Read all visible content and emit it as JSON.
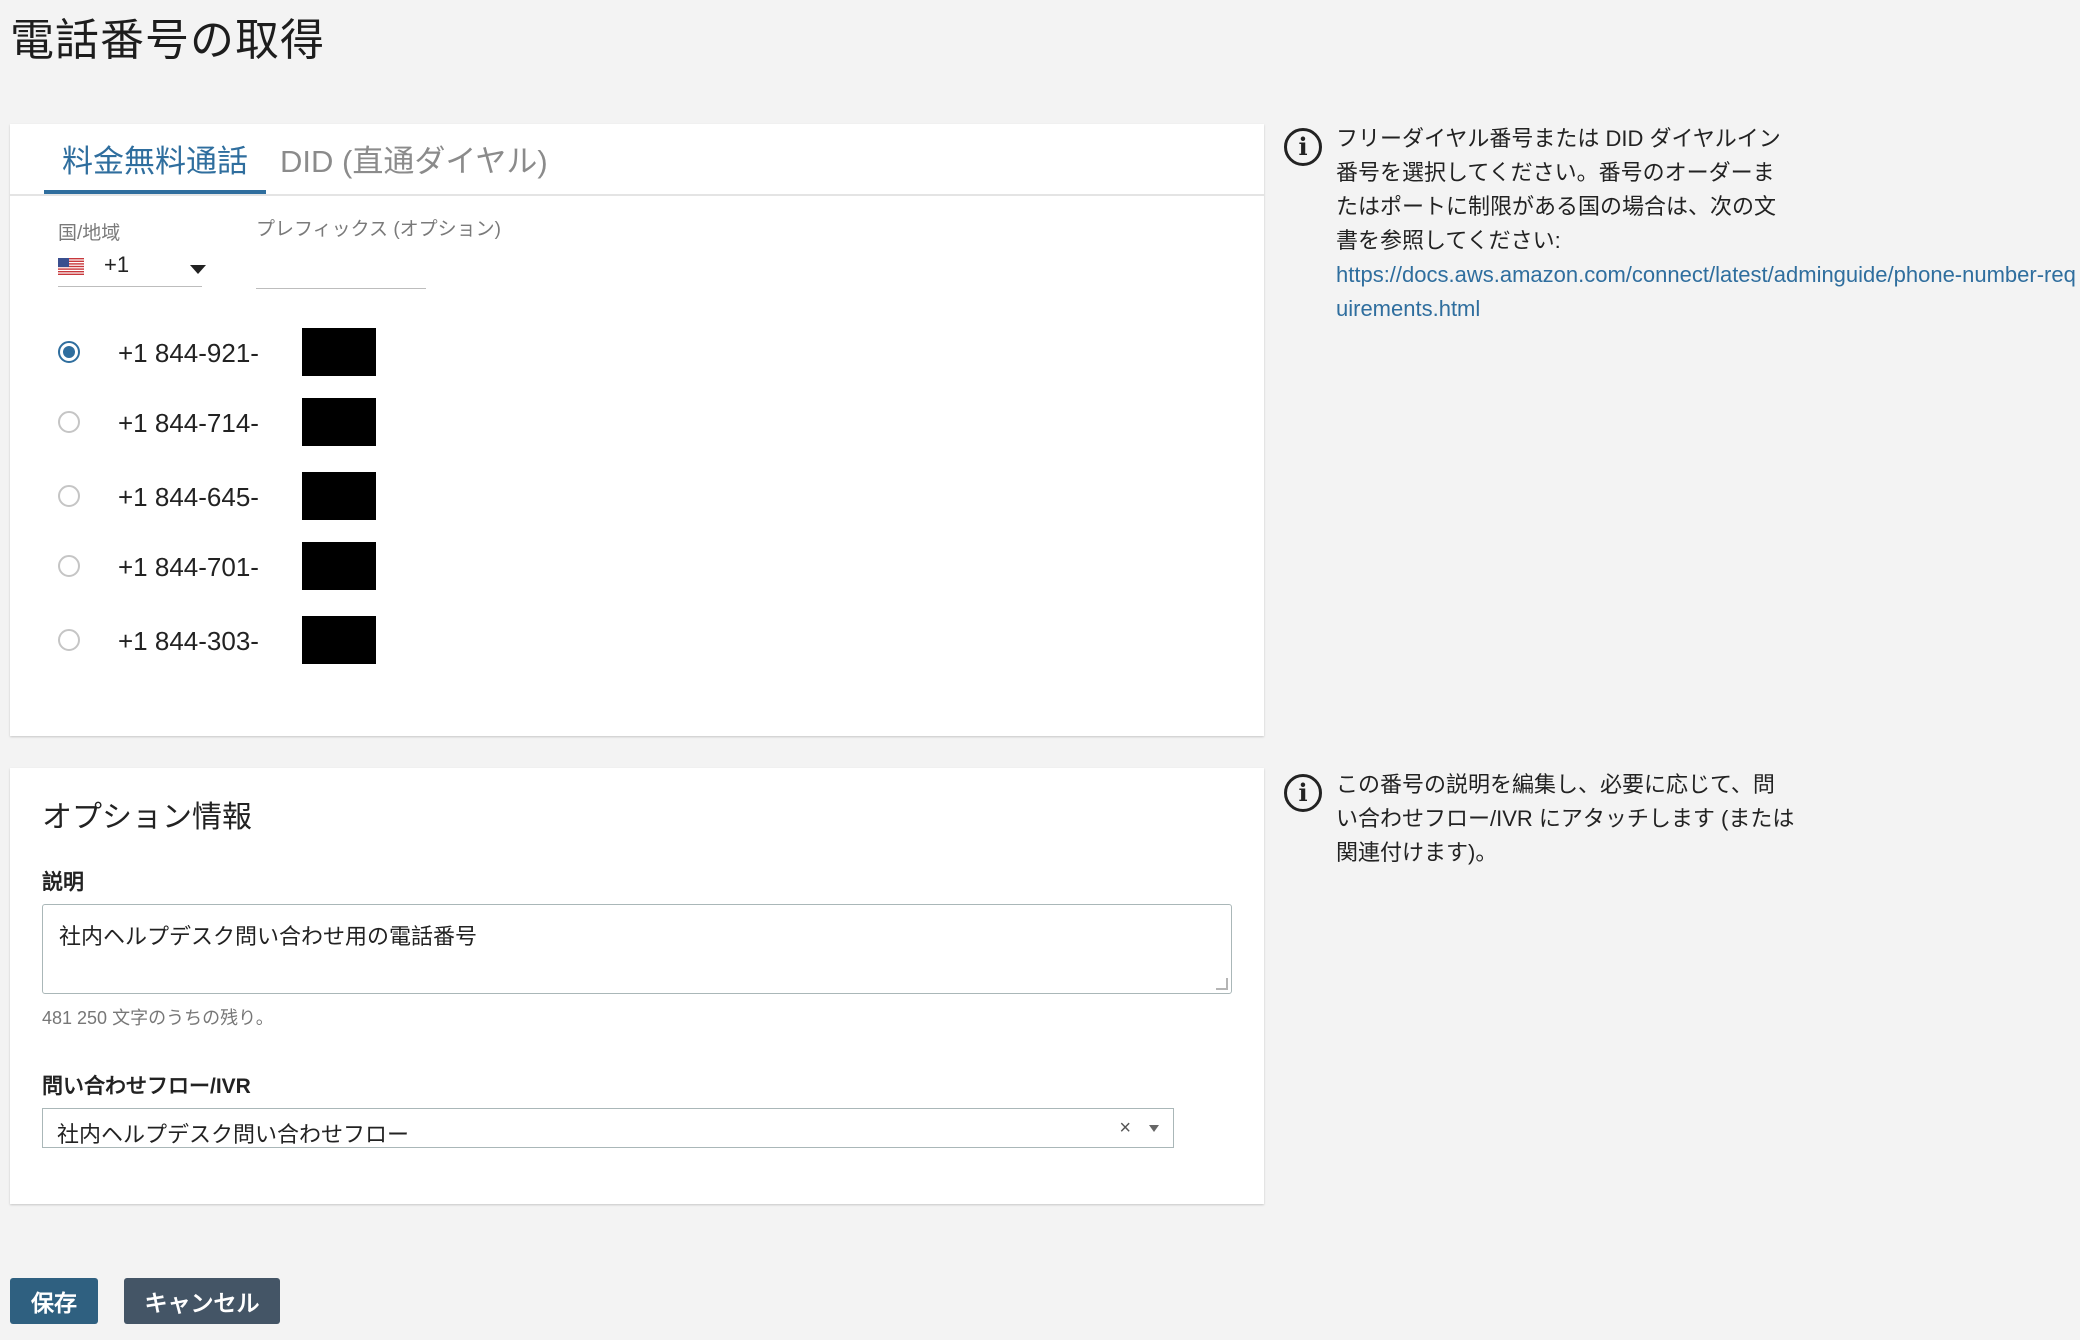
{
  "page": {
    "title": "電話番号の取得"
  },
  "tabs": [
    {
      "label": "料金無料通話",
      "active": true
    },
    {
      "label": "DID (直通ダイヤル)",
      "active": false
    }
  ],
  "country": {
    "label": "国/地域",
    "code": "+1",
    "flag_icon": "us-flag-icon"
  },
  "prefix": {
    "label": "プレフィックス (オプション)",
    "value": ""
  },
  "numbers": [
    {
      "text": "+1 844-921-",
      "selected": true
    },
    {
      "text": "+1 844-714-",
      "selected": false
    },
    {
      "text": "+1 844-645-",
      "selected": false
    },
    {
      "text": "+1 844-701-",
      "selected": false
    },
    {
      "text": "+1 844-303-",
      "selected": false
    }
  ],
  "options": {
    "title": "オプション情報",
    "description_label": "説明",
    "description_value": "社内ヘルプデスク問い合わせ用の電話番号",
    "chars_remaining": "481 250 文字のうちの残り。",
    "flow_label": "問い合わせフロー/IVR",
    "flow_value": "社内ヘルプデスク問い合わせフロー"
  },
  "info": {
    "numbers_text": "フリーダイヤル番号または DID ダイヤルイン番号を選択してください。番号のオーダーまたはポートに制限がある国の場合は、次の文書を参照してください:",
    "numbers_link": "https://docs.aws.amazon.com/connect/latest/adminguide/phone-number-requirements.html",
    "options_text": "この番号の説明を編集し、必要に応じて、問い合わせフロー/IVR にアタッチします (または関連付けます)。"
  },
  "buttons": {
    "save": "保存",
    "cancel": "キャンセル"
  },
  "colors": {
    "accent": "#2f6e9e",
    "save_button": "#2f6080",
    "cancel_button": "#445566"
  }
}
